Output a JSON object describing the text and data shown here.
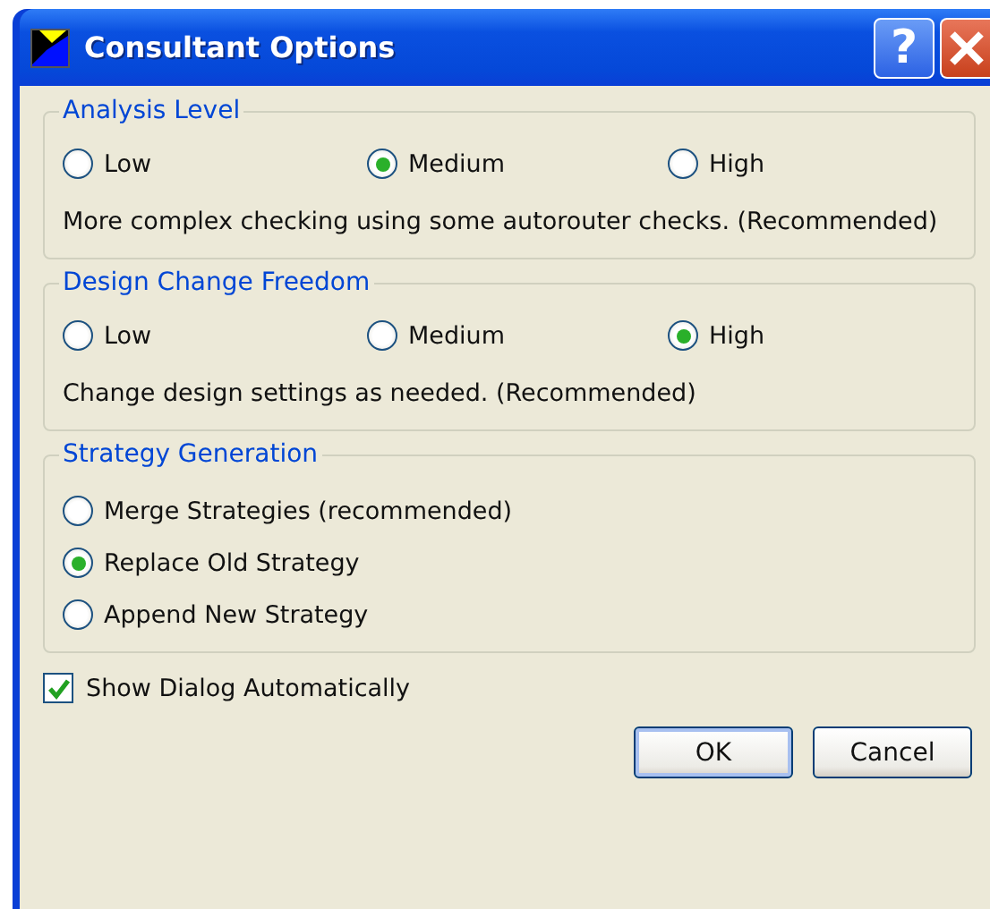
{
  "window": {
    "title": "Consultant Options",
    "help_button": "?"
  },
  "groups": [
    {
      "title": "Analysis Level",
      "kind": "row",
      "options": [
        {
          "label": "Low",
          "selected": false
        },
        {
          "label": "Medium",
          "selected": true
        },
        {
          "label": "High",
          "selected": false
        }
      ],
      "description": "More complex checking using some autorouter checks. (Recommended)"
    },
    {
      "title": "Design Change Freedom",
      "kind": "row",
      "options": [
        {
          "label": "Low",
          "selected": false
        },
        {
          "label": "Medium",
          "selected": false
        },
        {
          "label": "High",
          "selected": true
        }
      ],
      "description": "Change design settings as needed. (Recommended)"
    },
    {
      "title": "Strategy Generation",
      "kind": "column",
      "options": [
        {
          "label": "Merge Strategies (recommended)",
          "selected": false
        },
        {
          "label": "Replace Old Strategy",
          "selected": true
        },
        {
          "label": "Append New Strategy",
          "selected": false
        }
      ]
    }
  ],
  "show_dialog": {
    "label": "Show Dialog Automatically",
    "checked": true
  },
  "buttons": [
    {
      "label": "OK",
      "default": true
    },
    {
      "label": "Cancel",
      "default": false
    }
  ]
}
